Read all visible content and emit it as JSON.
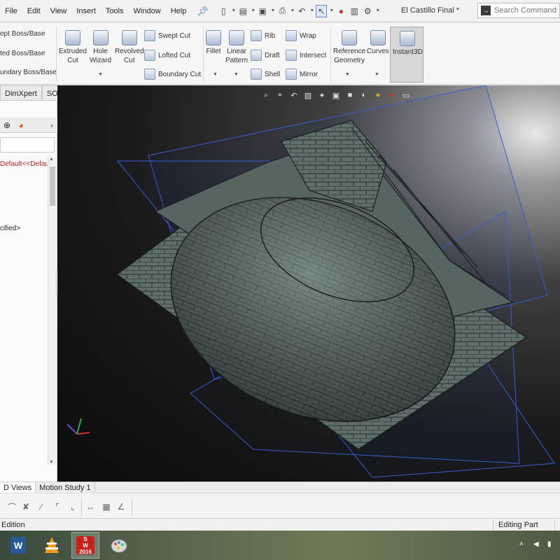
{
  "menubar": {
    "items": [
      "File",
      "Edit",
      "View",
      "Insert",
      "Tools",
      "Window",
      "Help"
    ],
    "document_title": "El Castillo Final *",
    "search_placeholder": "Search Commands"
  },
  "ribbon": {
    "boss_features": [
      "Swept Boss/Base",
      "Lofted Boss/Base",
      "Boundary Boss/Base"
    ],
    "boss_visible_text": [
      "ept Boss/Base",
      "ted Boss/Base",
      "undary Boss/Base"
    ],
    "extruded_cut": [
      "Extruded",
      "Cut"
    ],
    "hole_wizard": [
      "Hole",
      "Wizard"
    ],
    "revolved_cut": [
      "Revolved",
      "Cut"
    ],
    "cut_features": [
      "Swept Cut",
      "Lofted Cut",
      "Boundary Cut"
    ],
    "fillet": "Fillet",
    "linear_pattern": [
      "Linear",
      "Pattern"
    ],
    "rib_group": [
      "Rib",
      "Draft",
      "Shell"
    ],
    "wrap_group": [
      "Wrap",
      "Intersect",
      "Mirror"
    ],
    "reference_geometry": [
      "Reference",
      "Geometry"
    ],
    "curves": "Curves",
    "instant3d": "Instant3D"
  },
  "command_tabs": [
    "DimXpert",
    "SOLIDWORKS MBD"
  ],
  "feature_manager": {
    "config_text": "Default<<Default",
    "material_text": "cified>"
  },
  "bottom_tabs": [
    "D Views",
    "Motion Study 1"
  ],
  "status": {
    "left": "Edition",
    "right": "Editing Part"
  },
  "taskbar": {
    "apps": [
      "word-icon",
      "vlc-icon",
      "solidworks-icon",
      "paint-icon"
    ],
    "solidworks_label": [
      "S",
      "W",
      "2016"
    ],
    "word_letter": "W"
  },
  "colors": {
    "viewport_dark": "#0c0c0c",
    "plane_blue": "#3a5bd0",
    "stone": "#5d6b6a",
    "config_red": "#b02020"
  }
}
